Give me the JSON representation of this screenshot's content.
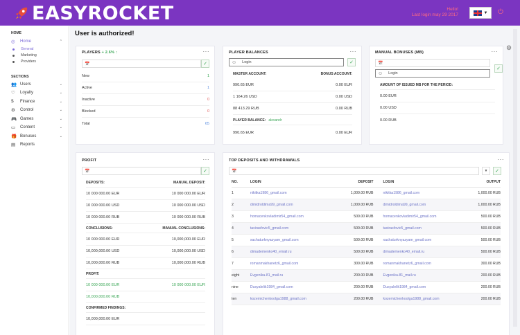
{
  "header": {
    "logo_text": "EASYROCKET",
    "hello": "Hello!",
    "last_login": "Last login may 29 2017",
    "lang_caret": "▼",
    "power_icon": "⏻"
  },
  "sidebar": {
    "home_heading": "HOME",
    "home_item": "Home",
    "home_sub": [
      "General",
      "Marketing",
      "Providers"
    ],
    "sections_heading": "SECTIONS",
    "items": [
      {
        "icon": "👥",
        "label": "Users"
      },
      {
        "icon": "♡",
        "label": "Loyalty"
      },
      {
        "icon": "$",
        "label": "Finance"
      },
      {
        "icon": "⚙",
        "label": "Control"
      },
      {
        "icon": "🎮",
        "label": "Games"
      },
      {
        "icon": "▭",
        "label": "Content"
      },
      {
        "icon": "🎁",
        "label": "Bonuses"
      },
      {
        "icon": "▤",
        "label": "Reports"
      }
    ]
  },
  "page_title": "User is authorized!",
  "players": {
    "title": "PLAYERS",
    "change": "+ 2.6% ↑",
    "rows": [
      {
        "label": "New",
        "value": "1"
      },
      {
        "label": "Active",
        "value": "1"
      },
      {
        "label": "Inactive",
        "value": "0"
      },
      {
        "label": "Blocked",
        "value": "0"
      },
      {
        "label": "Total",
        "value": "65"
      }
    ]
  },
  "balances": {
    "title": "PLAYER BALANCES",
    "login_placeholder": "Login",
    "master_label": "MASTER ACCOUNT:",
    "bonus_label": "BONUS ACCOUNT:",
    "rows": [
      {
        "a": "990.65 EUR",
        "b": "0.00 EUR"
      },
      {
        "a": "1 164.26 USD",
        "b": "0.00 USD"
      },
      {
        "a": "88 413.29 RUB",
        "b": "0.00 RUB"
      }
    ],
    "player_balance_label": "PLAYER BALANCE:",
    "player_name": "alexandr",
    "player_row": {
      "a": "990.65 EUR",
      "b": "0.00 EUR"
    }
  },
  "manual_bonuses": {
    "title": "MANUAL BONUSES (MB)",
    "login_placeholder": "Login",
    "period_label": "AMOUNT OF ISSUED MB FOR THE PERIOD:",
    "rows": [
      "0.00 EUR",
      "0.00 USD",
      "0.00 RUB"
    ]
  },
  "profit": {
    "title": "PROFIT",
    "deposits_label": "DEPOSITS:",
    "manual_deposit_label": "MANUAL DEPOSIT:",
    "deposits": [
      {
        "a": "10 000 000.00 EUR",
        "b": "10 000 000.00 EUR"
      },
      {
        "a": "10 000 000.00 USD",
        "b": "10 000 000.00 USD"
      },
      {
        "a": "10 000 000.00 RUB",
        "b": "10 000 000.00 RUB"
      }
    ],
    "conclusions_label": "CONCLUSIONS:",
    "manual_conclusions_label": "MANUAL CONCLUSIONS:",
    "conclusions": [
      {
        "a": "10 000 000.00 EUR",
        "b": "10,000,000.00 EUR"
      },
      {
        "a": "10,000,000.00 USD",
        "b": "10,000,000.00 USD"
      },
      {
        "a": "10,000,000.00 RUB",
        "b": "10,000,000.00 RUB"
      }
    ],
    "profit_label": "PROFIT:",
    "profit_rows": [
      {
        "a": "10 000 000.00 EUR",
        "b": "10 000 000.00 EUR"
      },
      {
        "a": "10,000,000.00 RUB",
        "b": ""
      }
    ],
    "confirmed_label": "CONFIRMED FINDINGS:",
    "confirmed_rows": [
      {
        "a": "10,000,000.00 EUR",
        "b": ""
      }
    ]
  },
  "top": {
    "title": "TOP DEPOSITS AND WITHDRAWALS",
    "headers": {
      "no": "NO.",
      "login": "LOGIN",
      "deposit": "DEPOSIT",
      "login2": "LOGIN",
      "output": "OUTPUT"
    },
    "rows": [
      {
        "no": "1",
        "login": "nikitka1986_gmail.com",
        "deposit": "1,000.00 RUB",
        "login2": "nikitka1986_gmail.com",
        "output": "1,000.00 RUB"
      },
      {
        "no": "2",
        "login": "dimidroldima99_gmail.com",
        "deposit": "1,000.00 RUB",
        "login2": "dimidroldima99_gmail.com",
        "output": "1,000.00 RUB"
      },
      {
        "no": "3",
        "login": "homacenkovladimir54_gmail.com",
        "deposit": "500.00 RUB",
        "login2": "homacenkovladimir54_gmail.com",
        "output": "500.00 RUB"
      },
      {
        "no": "4",
        "login": "taxirasfovic5_gmail.com",
        "deposit": "500.00 RUB",
        "login2": "taxirasfovic5_gmail.com",
        "output": "500.00 RUB"
      },
      {
        "no": "5",
        "login": "xachaturknyazyam_gmail.com",
        "deposit": "500.00 RUB",
        "login2": "xachaturknyazyam_gmail.com",
        "output": "500.00 RUB"
      },
      {
        "no": "6",
        "login": "dimademenko40_email.ru",
        "deposit": "500.00 RUB",
        "login2": "dimademenko40_email.ru",
        "output": "500.00 RUB"
      },
      {
        "no": "7",
        "login": "romanmakhanetz6_gmail.com",
        "deposit": "300.00 RUB",
        "login2": "romanmakhanetz6_gmail.com",
        "output": "300.00 RUB"
      },
      {
        "no": "eight",
        "login": "Evgenika-81_mail.ru",
        "deposit": "200.00 RUB",
        "login2": "Evgenika-81_mail.ru",
        "output": "200.00 RUB"
      },
      {
        "no": "nine",
        "login": "Dusyalelik1984_gmail.com",
        "deposit": "200.00 RUB",
        "login2": "Dusyalelik1984_gmail.com",
        "output": "200.00 RUB"
      },
      {
        "no": "ten",
        "login": "kozemichenkoolga1988_gmail.com",
        "deposit": "200.00 RUB",
        "login2": "kozemichenkoolga1988_gmail.com",
        "output": "200.00 RUB"
      }
    ]
  },
  "icons": {
    "calendar": "📅",
    "check": "✓",
    "more": "···",
    "smile": "☺",
    "gear": "⚙"
  }
}
